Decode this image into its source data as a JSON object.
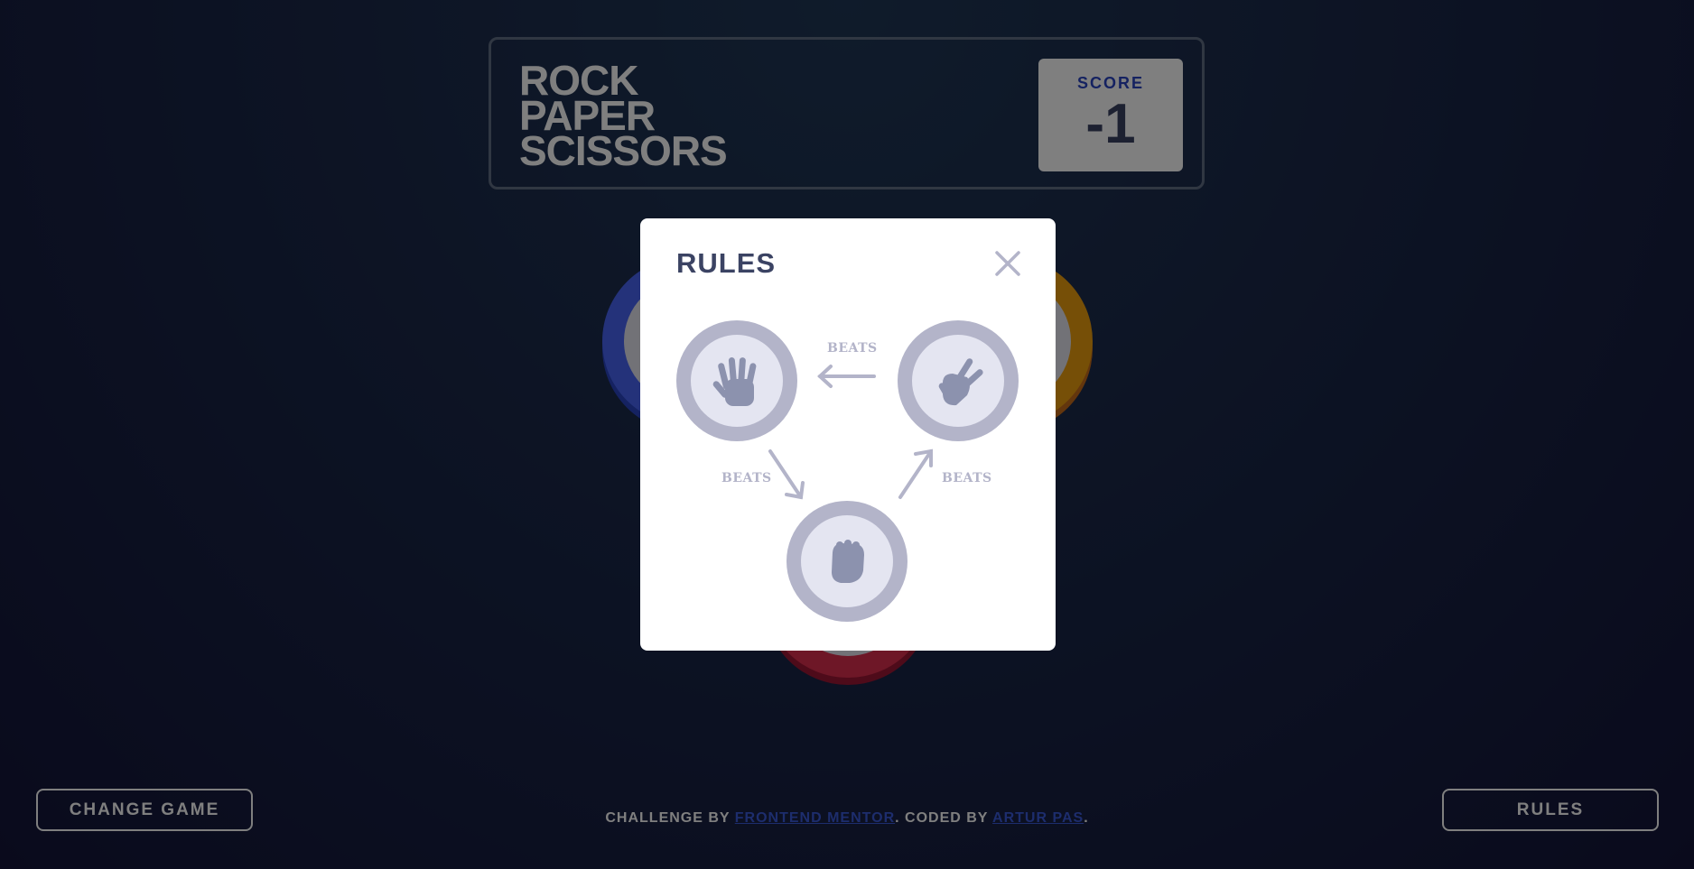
{
  "header": {
    "title_lines": [
      "ROCK",
      "PAPER",
      "SCISSORS"
    ],
    "score_label": "SCORE",
    "score_value": "-1"
  },
  "tokens": [
    {
      "name": "paper",
      "icon": "hand-paper-icon",
      "color": "#4865f4"
    },
    {
      "name": "scissors",
      "icon": "hand-scissors-icon",
      "color": "#ec9e0e"
    },
    {
      "name": "rock",
      "icon": "hand-rock-icon",
      "color": "#dc2e4e"
    }
  ],
  "buttons": {
    "change_game": "CHANGE GAME",
    "rules": "RULES"
  },
  "footer": {
    "prefix": "CHALLENGE BY ",
    "mentor_link": "FRONTEND MENTOR",
    "middle": ". CODED BY ",
    "author_link": "ARTUR PAS",
    "suffix": "."
  },
  "modal": {
    "title": "RULES",
    "close_icon": "close-icon",
    "beats_top": "BEATS",
    "beats_left": "BEATS",
    "beats_right": "BEATS"
  },
  "colors": {
    "score_label": "#2a45c2",
    "dark_text": "#3b4363",
    "link": "#3b5bdb",
    "rules_icon": "#8c92ae",
    "rules_ring": "#b3b4c9"
  }
}
